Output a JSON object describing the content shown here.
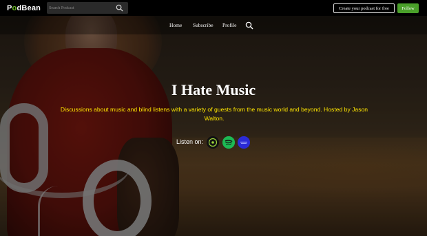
{
  "header": {
    "logo_prefix": "P",
    "logo_o": "o",
    "logo_suffix": "dBean",
    "search_placeholder": "Search Podcast",
    "create_label": "Create your podcast for free",
    "follow_label": "Follow"
  },
  "nav": {
    "items": [
      {
        "label": "Home"
      },
      {
        "label": "Subscribe"
      },
      {
        "label": "Profile"
      }
    ]
  },
  "podcast": {
    "title": "I Hate Music",
    "description": "Discussions about music and blind listens with a variety of guests from the music world and beyond. Hosted by Jason Walton.",
    "listen_label": "Listen on:",
    "platforms": [
      {
        "name": "podbean-icon",
        "color": "#111111"
      },
      {
        "name": "spotify-icon",
        "color": "#1db954"
      },
      {
        "name": "podcast-app-icon",
        "color": "#2b2bd6"
      }
    ]
  },
  "colors": {
    "accent_green": "#4aa02a",
    "description_yellow": "#ffe600"
  }
}
